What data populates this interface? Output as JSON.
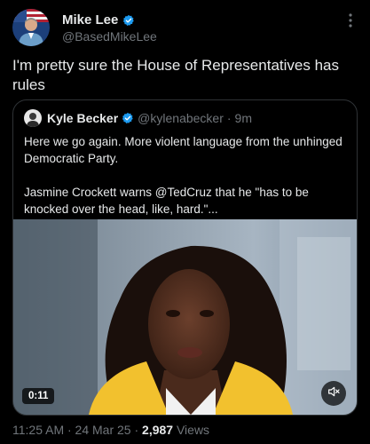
{
  "tweet": {
    "author": {
      "name": "Mike Lee",
      "handle": "@BasedMikeLee"
    },
    "text": "I'm pretty sure the House of Representatives has rules",
    "timestamp": "11:25 AM · 24 Mar 25 ·",
    "views_count": "2,987",
    "views_label": "Views"
  },
  "quote": {
    "author": {
      "name": "Kyle Becker",
      "handle": "@kylenabecker",
      "time": "9m"
    },
    "separator": "·",
    "text_line1": "Here we go again. More violent language from the unhinged Democratic Party.",
    "text_line2": "Jasmine Crockett warns @TedCruz that he \"has to be knocked over the head, like, hard.\"...",
    "video": {
      "duration": "0:11",
      "muted": true
    }
  },
  "icons": {
    "verified": "verified-badge-icon",
    "more": "more-options-icon",
    "mute": "speaker-muted-icon"
  },
  "colors": {
    "background": "#000000",
    "text_primary": "#e7e9ea",
    "text_secondary": "#71767b",
    "verified_blue": "#1d9bf0",
    "border": "#2f3336"
  }
}
